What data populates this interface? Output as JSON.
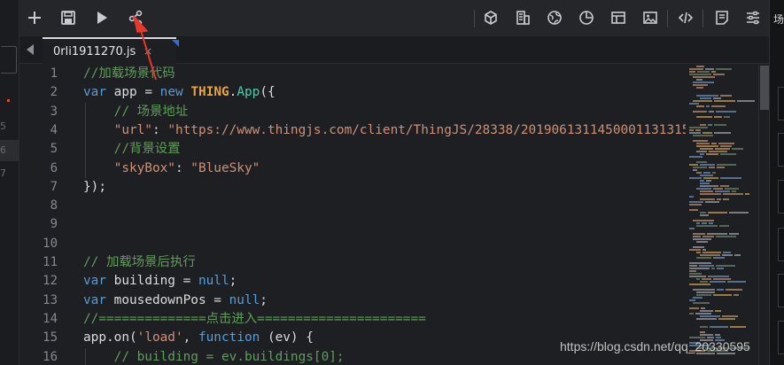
{
  "toolbar": {
    "left_buttons": [
      {
        "icon": "plus-icon",
        "name": "new-file-button"
      },
      {
        "icon": "save-icon",
        "name": "save-button"
      },
      {
        "icon": "play-icon",
        "name": "run-button"
      },
      {
        "icon": "share-icon",
        "name": "share-button"
      }
    ],
    "right_buttons": [
      {
        "icon": "cube-icon",
        "name": "object-button"
      },
      {
        "icon": "building-icon",
        "name": "building-button"
      },
      {
        "icon": "globe-icon",
        "name": "earth-button"
      },
      {
        "icon": "pie-chart-icon",
        "name": "chart-button"
      },
      {
        "icon": "layout-icon",
        "name": "layout-button"
      },
      {
        "icon": "image-icon",
        "name": "image-button"
      },
      {
        "icon": "code-icon",
        "name": "code-button"
      },
      {
        "icon": "document-icon",
        "name": "document-button"
      },
      {
        "icon": "sliders-icon",
        "name": "settings-button"
      }
    ]
  },
  "right_panel": {
    "title": "场"
  },
  "left_strip": {
    "numbers": [
      "5",
      "6",
      "7"
    ]
  },
  "tab": {
    "label": "0rli1911270.js",
    "close": "×"
  },
  "editor": {
    "lines": [
      {
        "n": "1",
        "tokens": [
          {
            "t": "//加载场景代码",
            "c": "cm"
          }
        ]
      },
      {
        "n": "2",
        "tokens": [
          {
            "t": "var",
            "c": "kw"
          },
          {
            "t": " app = ",
            "c": "txt"
          },
          {
            "t": "new",
            "c": "kw"
          },
          {
            "t": " ",
            "c": "txt"
          },
          {
            "t": "THING",
            "c": "cls"
          },
          {
            "t": ".",
            "c": "txt"
          },
          {
            "t": "App",
            "c": "fn"
          },
          {
            "t": "({",
            "c": "txt"
          }
        ]
      },
      {
        "n": "3",
        "tokens": [
          {
            "t": "    ",
            "c": "txt"
          },
          {
            "t": "// 场景地址",
            "c": "cm"
          }
        ]
      },
      {
        "n": "4",
        "tokens": [
          {
            "t": "    ",
            "c": "txt"
          },
          {
            "t": "\"url\"",
            "c": "str"
          },
          {
            "t": ": ",
            "c": "txt"
          },
          {
            "t": "\"https://www.thingjs.com/client/ThingJS/28338/20190613114500011313150",
            "c": "str"
          }
        ]
      },
      {
        "n": "5",
        "tokens": [
          {
            "t": "    ",
            "c": "txt"
          },
          {
            "t": "//背景设置",
            "c": "cm"
          }
        ]
      },
      {
        "n": "6",
        "tokens": [
          {
            "t": "    ",
            "c": "txt"
          },
          {
            "t": "\"skyBox\"",
            "c": "str"
          },
          {
            "t": ": ",
            "c": "txt"
          },
          {
            "t": "\"BlueSky\"",
            "c": "str"
          }
        ]
      },
      {
        "n": "7",
        "tokens": [
          {
            "t": "});",
            "c": "txt"
          }
        ]
      },
      {
        "n": "8",
        "tokens": []
      },
      {
        "n": "9",
        "tokens": []
      },
      {
        "n": "10",
        "tokens": []
      },
      {
        "n": "11",
        "tokens": [
          {
            "t": "// 加载场景后执行",
            "c": "cm"
          }
        ]
      },
      {
        "n": "12",
        "tokens": [
          {
            "t": "var",
            "c": "kw"
          },
          {
            "t": " building = ",
            "c": "txt"
          },
          {
            "t": "null",
            "c": "kw"
          },
          {
            "t": ";",
            "c": "txt"
          }
        ]
      },
      {
        "n": "13",
        "tokens": [
          {
            "t": "var",
            "c": "kw"
          },
          {
            "t": " mousedownPos = ",
            "c": "txt"
          },
          {
            "t": "null",
            "c": "kw"
          },
          {
            "t": ";",
            "c": "txt"
          }
        ]
      },
      {
        "n": "14",
        "tokens": [
          {
            "t": "//==============点击进入======================",
            "c": "cm"
          }
        ]
      },
      {
        "n": "15",
        "tokens": [
          {
            "t": "app.on(",
            "c": "txt"
          },
          {
            "t": "'load'",
            "c": "str"
          },
          {
            "t": ", ",
            "c": "txt"
          },
          {
            "t": "function",
            "c": "kw"
          },
          {
            "t": " (ev) {",
            "c": "txt"
          }
        ]
      },
      {
        "n": "16",
        "tokens": [
          {
            "t": "    ",
            "c": "txt"
          },
          {
            "t": "// building = ev.buildings[0];",
            "c": "cm"
          }
        ]
      }
    ]
  },
  "watermark": "https://blog.csdn.net/qq_20330595",
  "colors": {
    "comment": "#5f9d5a",
    "keyword": "#569cd6",
    "string": "#ce9178",
    "class": "#e8a33d",
    "function": "#4ec9b0",
    "arrow": "#e8372c"
  }
}
